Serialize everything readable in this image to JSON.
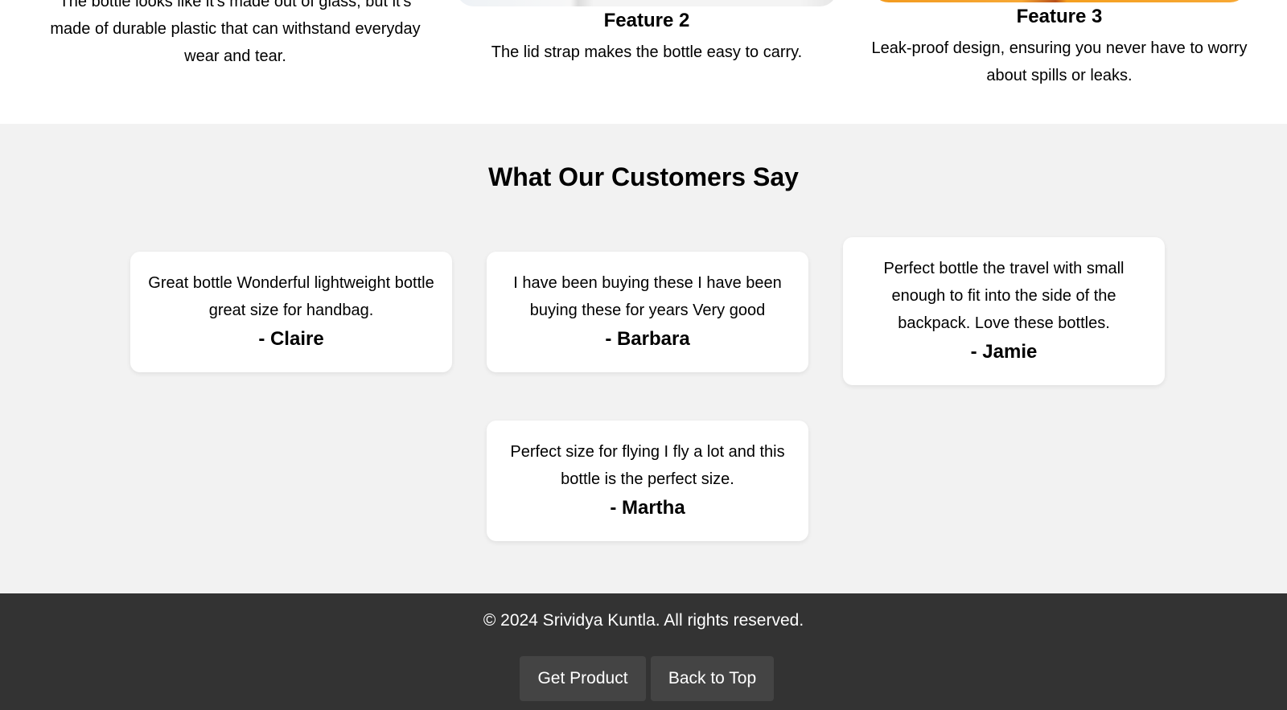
{
  "features": [
    {
      "title": "",
      "desc": "The bottle looks like it's made out of glass, but it's made of durable plastic that can withstand everyday wear and tear."
    },
    {
      "title": "Feature 2",
      "desc": "The lid strap makes the bottle easy to carry."
    },
    {
      "title": "Feature 3",
      "desc": "Leak-proof design, ensuring you never have to worry about spills or leaks."
    }
  ],
  "testimonials": {
    "title": "What Our Customers Say",
    "items": [
      {
        "quote": "Great bottle Wonderful lightweight bottle great size for handbag.",
        "author": "- Claire"
      },
      {
        "quote": "I have been buying these I have been buying these for years Very good",
        "author": "- Barbara"
      },
      {
        "quote": "Perfect bottle the travel with small enough to fit into the side of the backpack. Love these bottles.",
        "author": "- Jamie"
      },
      {
        "quote": "Perfect size for flying I fly a lot and this bottle is the perfect size.",
        "author": "- Martha"
      }
    ]
  },
  "footer": {
    "copyright": "© 2024 Srividya Kuntla. All rights reserved.",
    "get_product_label": "Get Product",
    "back_to_top_label": "Back to Top"
  },
  "colors": {
    "section_bg": "#f2f2f2",
    "footer_bg": "#333333",
    "button_bg": "#444444",
    "feature3_accent": "#f5a623"
  }
}
